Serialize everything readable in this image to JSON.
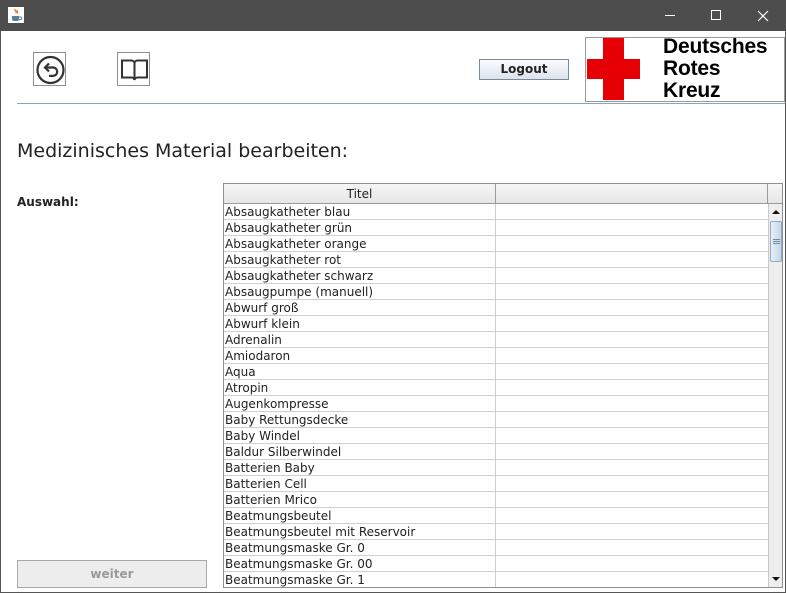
{
  "window": {
    "app_icon": "java-cup-icon",
    "controls": [
      "minimize-icon",
      "maximize-icon",
      "close-icon"
    ]
  },
  "toolbar": {
    "back_icon": "back-arrow-icon",
    "manual_icon": "book-icon",
    "logout_label": "Logout"
  },
  "logo": {
    "line1": "Deutsches",
    "line2": "Rotes",
    "line3": "Kreuz",
    "cross_color": "#e60005"
  },
  "page": {
    "title": "Medizinisches Material bearbeiten:",
    "selection_label": "Auswahl:",
    "next_button": "weiter"
  },
  "table": {
    "columns": [
      "Titel",
      ""
    ],
    "rows": [
      [
        "Absaugkatheter blau",
        ""
      ],
      [
        "Absaugkatheter grün",
        ""
      ],
      [
        "Absaugkatheter orange",
        ""
      ],
      [
        "Absaugkatheter rot",
        ""
      ],
      [
        "Absaugkatheter schwarz",
        ""
      ],
      [
        "Absaugpumpe (manuell)",
        ""
      ],
      [
        "Abwurf groß",
        ""
      ],
      [
        "Abwurf klein",
        ""
      ],
      [
        "Adrenalin",
        ""
      ],
      [
        "Amiodaron",
        ""
      ],
      [
        "Aqua",
        ""
      ],
      [
        "Atropin",
        ""
      ],
      [
        "Augenkompresse",
        ""
      ],
      [
        "Baby Rettungsdecke",
        ""
      ],
      [
        "Baby Windel",
        ""
      ],
      [
        "Baldur Silberwindel",
        ""
      ],
      [
        "Batterien Baby",
        ""
      ],
      [
        "Batterien Cell",
        ""
      ],
      [
        "Batterien Mrico",
        ""
      ],
      [
        "Beatmungsbeutel",
        ""
      ],
      [
        "Beatmungsbeutel mit Reservoir",
        ""
      ],
      [
        "Beatmungsmaske Gr. 0",
        ""
      ],
      [
        "Beatmungsmaske Gr. 00",
        ""
      ],
      [
        "Beatmungsmaske Gr. 1",
        ""
      ]
    ]
  }
}
